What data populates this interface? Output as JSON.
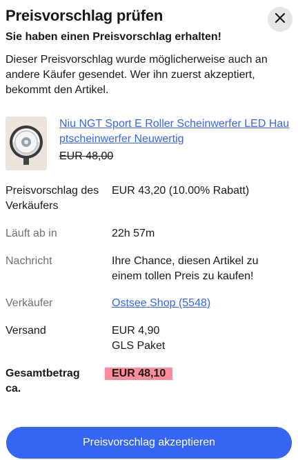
{
  "header": {
    "title": "Preisvorschlag prüfen",
    "close_icon": "close-icon"
  },
  "offer": {
    "subtitle": "Sie haben einen Preisvorschlag erhalten!",
    "info": "Dieser Preisvorschlag wurde möglicherweise auch an andere Käufer gesendet. Wer ihn zuerst akzeptiert, bekommt den Artikel."
  },
  "item": {
    "thumbnail_icon": "scooter-headlight-image",
    "title": "Niu   NGT Sport  E Roller Scheinwerfer LED Hauptscheinwerfer  Neuwertig",
    "original_price": "EUR 48,00"
  },
  "details": {
    "seller_offer_label": "Preisvorschlag des Verkäufers",
    "seller_offer_value": "EUR 43,20 (10.00% Rabatt)",
    "expires_label": "Läuft ab in",
    "expires_value": "22h 57m",
    "message_label": "Nachricht",
    "message_value": "Ihre Chance, diesen Artikel zu einem tollen Preis zu kaufen!",
    "seller_label": "Verkäufer",
    "seller_value": "Ostsee Shop (5548)",
    "shipping_label": "Versand",
    "shipping_price": "EUR 4,90",
    "shipping_method": "GLS Paket",
    "total_label": "Gesamtbetrag ca.",
    "total_value": "EUR 48,10"
  },
  "actions": {
    "accept_label": "Preisvorschlag akzeptieren"
  },
  "colors": {
    "accent": "#3665f3",
    "total_highlight": "#ff8c98",
    "close_bg": "#e5e5e5"
  }
}
